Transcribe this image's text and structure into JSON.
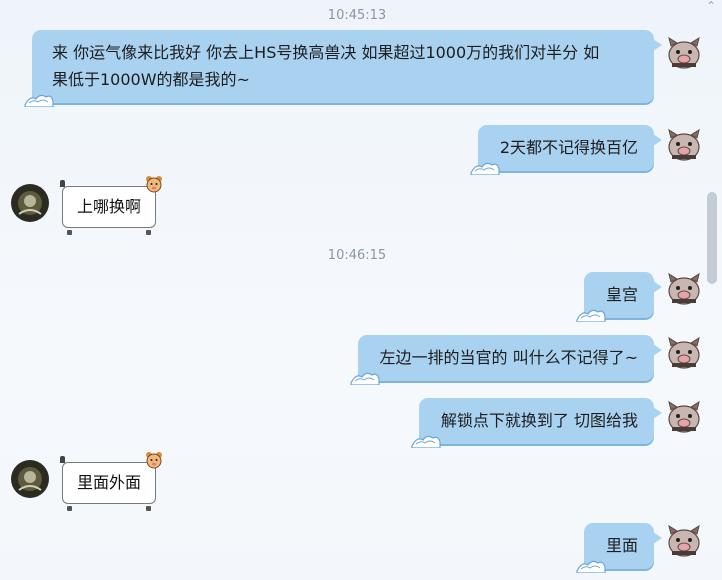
{
  "window": {
    "close_glyph": "⌃"
  },
  "messages": [
    {
      "side": "ts",
      "text": "10:45:13"
    },
    {
      "side": "right",
      "line1": "来 你运气像来比我好 你去上HS号换高兽决 如果超过1000万的我们对半分 如",
      "line2": "果低于1000W的都是我的~"
    },
    {
      "side": "right",
      "text": "2天都不记得换百亿"
    },
    {
      "side": "left",
      "text": "上哪换啊"
    },
    {
      "side": "ts",
      "text": "10:46:15"
    },
    {
      "side": "right",
      "text": "皇宫"
    },
    {
      "side": "right",
      "text": "左边一排的当官的 叫什么不记得了~"
    },
    {
      "side": "right",
      "text": "解锁点下就换到了 切图给我"
    },
    {
      "side": "left",
      "text": "里面外面"
    },
    {
      "side": "right",
      "text": "里面"
    }
  ],
  "colors": {
    "self_bubble": "#a9d2f1",
    "other_bubble": "#ffffff",
    "timestamp": "#8a96a3"
  },
  "icons": {
    "self_avatar": "pig-cartoon-avatar",
    "other_avatar": "dark-photo-avatar",
    "bubble_decoration": "wave-icon"
  }
}
